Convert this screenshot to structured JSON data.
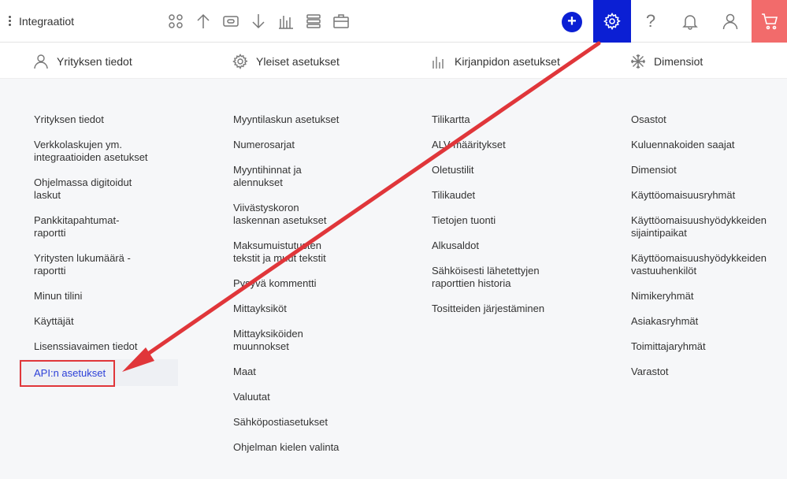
{
  "header": {
    "title": "Integraatiot",
    "toolbar_icons": [
      "apps-icon",
      "upload-icon",
      "payment-icon",
      "download-icon",
      "chart-icon",
      "list-icon",
      "briefcase-icon"
    ],
    "right_icons": [
      "plus-icon",
      "gear-icon",
      "help-icon",
      "bell-icon",
      "user-icon",
      "cart-icon"
    ],
    "help_label": "?"
  },
  "sections": [
    {
      "title": "Yrityksen tiedot",
      "icon": "user-icon"
    },
    {
      "title": "Yleiset asetukset",
      "icon": "gear-icon"
    },
    {
      "title": "Kirjanpidon asetukset",
      "icon": "chart-icon"
    },
    {
      "title": "Dimensiot",
      "icon": "snowflake-icon"
    }
  ],
  "columns": [
    {
      "items": [
        "Yrityksen tiedot",
        "Verkkolaskujen ym. integraatioiden asetukset",
        "Ohjelmassa digitoidut laskut",
        "Pankkitapahtumat-raportti",
        "Yritysten lukumäärä -raportti",
        "Minun tilini",
        "Käyttäjät",
        "Lisenssiavaimen tiedot"
      ],
      "highlighted": "API:n asetukset"
    },
    {
      "items": [
        "Myyntilaskun asetukset",
        "Numerosarjat",
        "Myyntihinnat ja alennukset",
        "Viivästyskoron laskennan asetukset",
        "Maksumuistutusten tekstit ja muut tekstit",
        "Pysyvä kommentti",
        "Mittayksiköt",
        "Mittayksiköiden muunnokset",
        "Maat",
        "Valuutat",
        "Sähköpostiasetukset",
        "Ohjelman kielen valinta"
      ]
    },
    {
      "items": [
        "Tilikartta",
        "ALV-määritykset",
        "Oletustilit",
        "Tilikaudet",
        "Tietojen tuonti",
        "Alkusaldot",
        "Sähköisesti lähetettyjen raporttien historia",
        "Tositteiden järjestäminen"
      ]
    },
    {
      "items": [
        "Osastot",
        "Kuluennakoiden saajat",
        "Dimensiot",
        "Käyttöomaisuusryhmät",
        "Käyttöomaisuushyödykkeiden sijaintipaikat",
        "Käyttöomaisuushyödykkeiden vastuuhenkilöt",
        "Nimikeryhmät",
        "Asiakasryhmät",
        "Toimittajaryhmät",
        "Varastot"
      ]
    }
  ],
  "colors": {
    "accent": "#0b1fd4",
    "cart": "#f26b6b",
    "annotation": "#e0363a",
    "link": "#2b3fd8"
  }
}
